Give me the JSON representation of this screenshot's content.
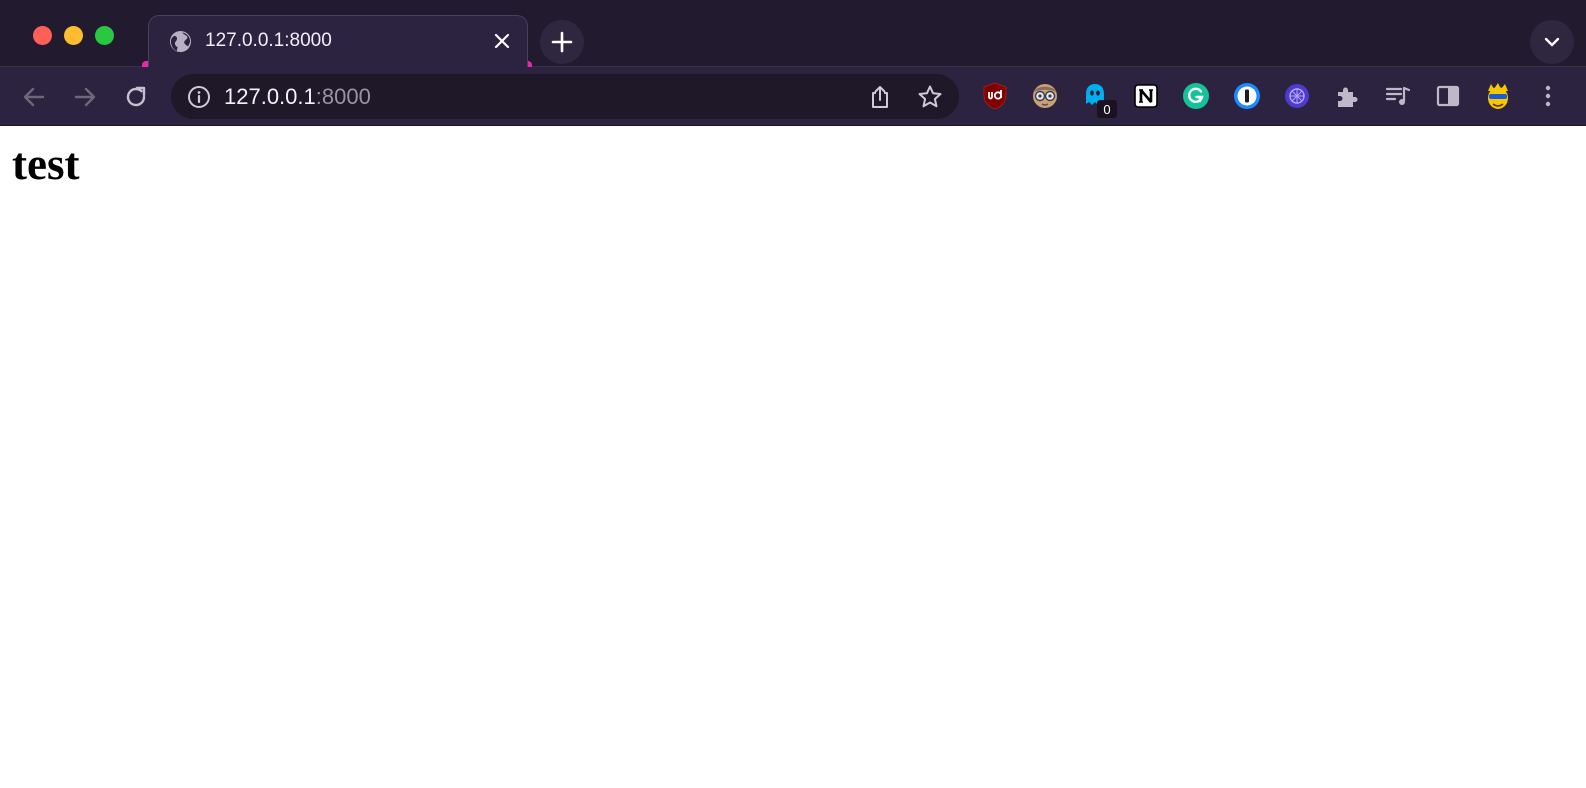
{
  "window": {
    "traffic_lights": {
      "close": "#fe5f57",
      "minimize": "#febc2e",
      "maximize": "#28c840"
    }
  },
  "tab": {
    "title": "127.0.0.1:8000",
    "favicon": "globe-icon",
    "accent_color": "#e42aa6"
  },
  "toolbar": {
    "back_icon": "arrow-left-icon",
    "forward_icon": "arrow-right-icon",
    "reload_icon": "reload-icon",
    "omnibox": {
      "host": "127.0.0.1",
      "port": ":8000",
      "info_icon": "info-icon",
      "share_icon": "share-icon",
      "bookmark_icon": "star-icon"
    },
    "extensions": [
      {
        "name": "ublock-origin-icon",
        "color": "#800000"
      },
      {
        "name": "glasses-avatar-icon",
        "color": "#c8a07a"
      },
      {
        "name": "ghostery-icon",
        "color": "#00aef0",
        "badge": "0"
      },
      {
        "name": "notion-icon",
        "color": "#ffffff"
      },
      {
        "name": "grammarly-icon",
        "color": "#15c39a"
      },
      {
        "name": "1password-icon",
        "color": "#1a8cff"
      },
      {
        "name": "purple-extension-icon",
        "color": "#4b3bd1"
      },
      {
        "name": "puzzle-icon",
        "color": "#bfb8c9"
      },
      {
        "name": "media-queue-icon",
        "color": "#bfb8c9"
      },
      {
        "name": "side-panel-icon",
        "color": "#bfb8c9"
      },
      {
        "name": "profile-avatar-icon",
        "color": "#f5c800"
      },
      {
        "name": "kebab-menu-icon",
        "color": "#bfb8c9"
      }
    ]
  },
  "page": {
    "heading": "test"
  }
}
